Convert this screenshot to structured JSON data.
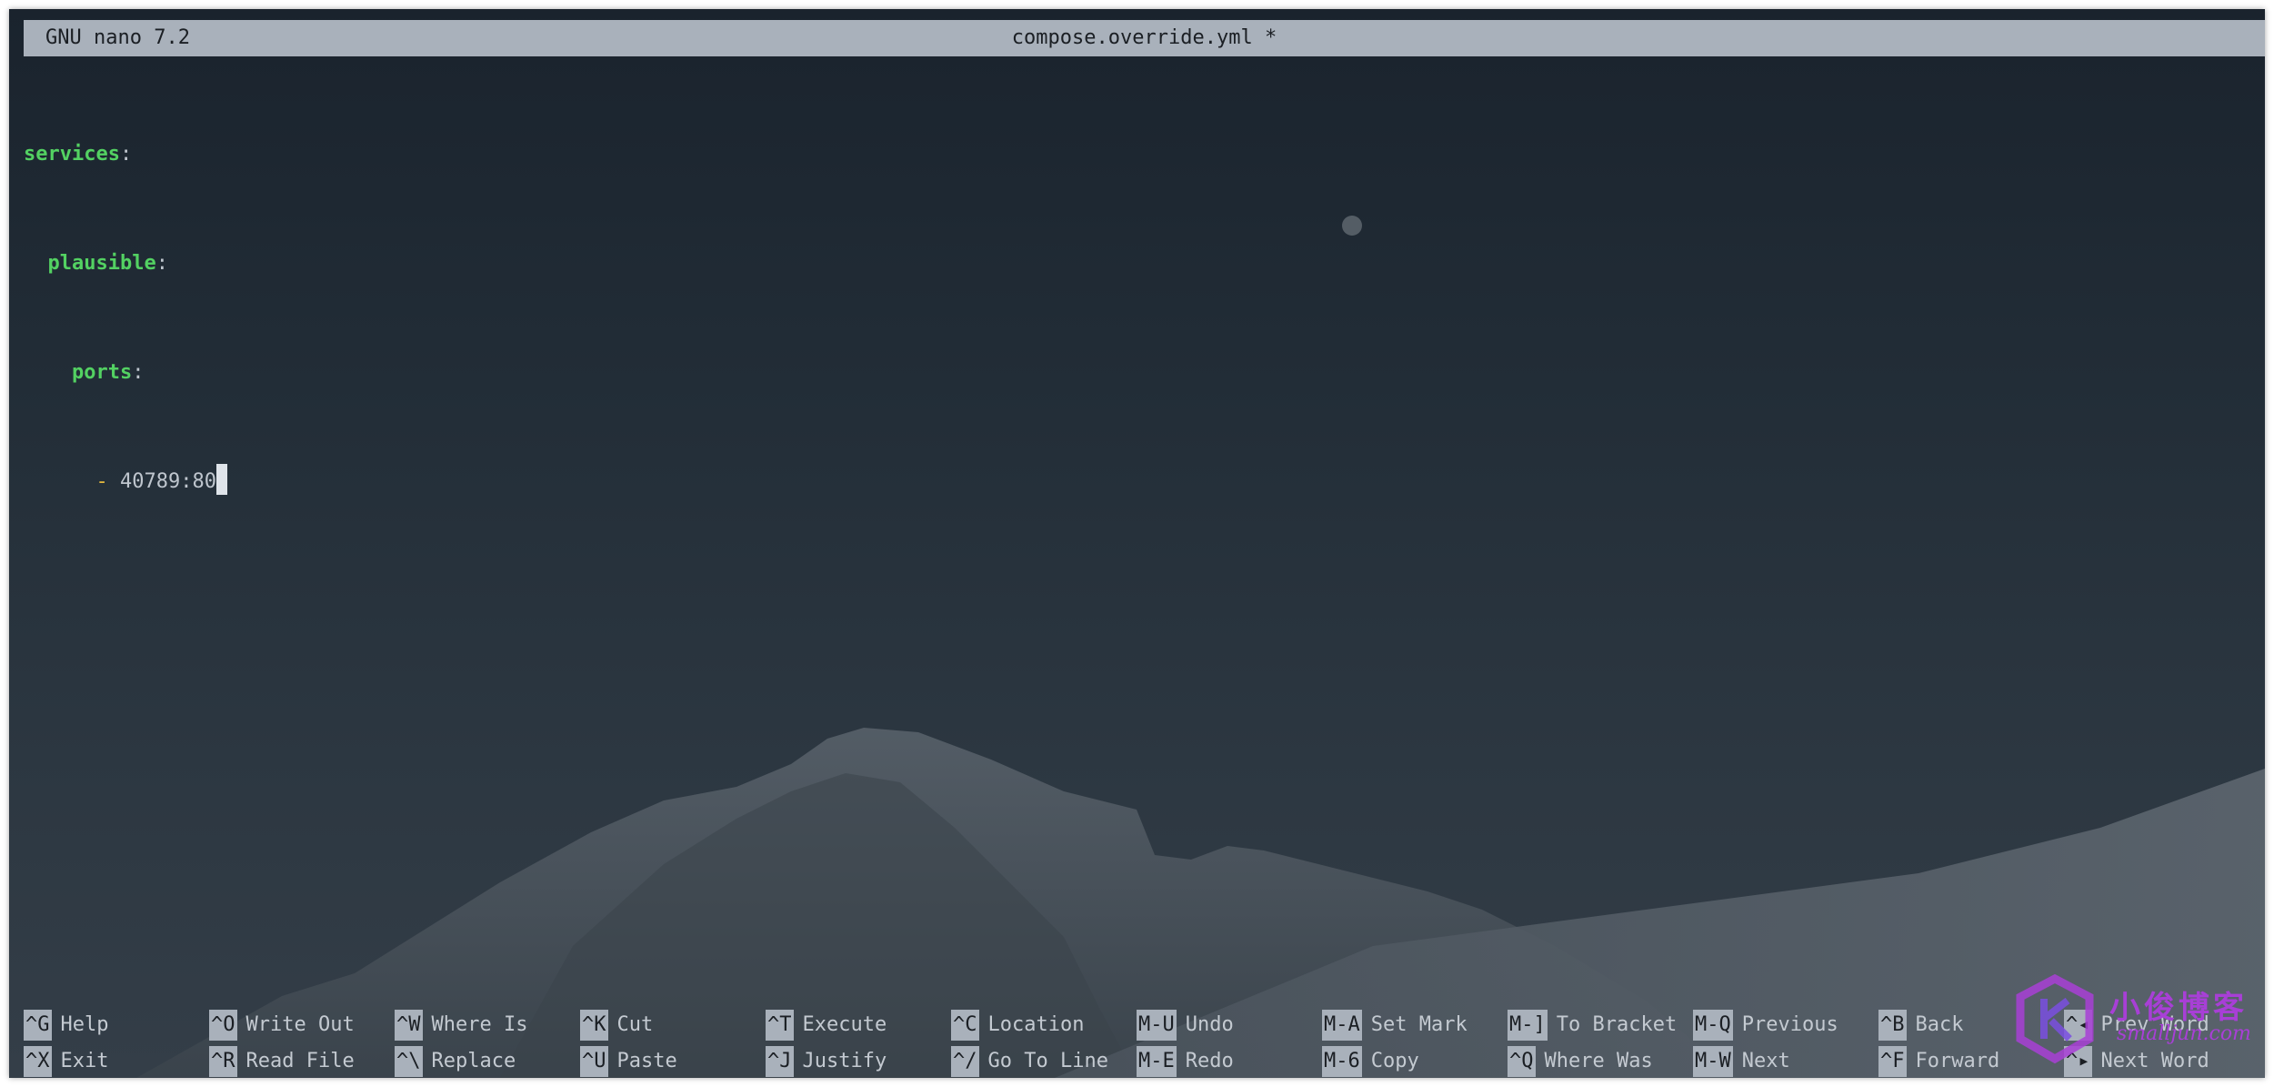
{
  "titlebar": {
    "version": "GNU nano 7.2",
    "filename": "compose.override.yml *"
  },
  "editor": {
    "line1_key": "services",
    "line2_key": "plausible",
    "line3_key": "ports",
    "line4_dash": "-",
    "line4_value": "40789:80",
    "colon": ":"
  },
  "shortcuts": [
    {
      "key": "^G",
      "label": "Help"
    },
    {
      "key": "^O",
      "label": "Write Out"
    },
    {
      "key": "^W",
      "label": "Where Is"
    },
    {
      "key": "^K",
      "label": "Cut"
    },
    {
      "key": "^T",
      "label": "Execute"
    },
    {
      "key": "^C",
      "label": "Location"
    },
    {
      "key": "M-U",
      "label": "Undo"
    },
    {
      "key": "M-A",
      "label": "Set Mark"
    },
    {
      "key": "M-]",
      "label": "To Bracket"
    },
    {
      "key": "M-Q",
      "label": "Previous"
    },
    {
      "key": "^B",
      "label": "Back"
    },
    {
      "key": "^◂",
      "label": "Prev Word"
    },
    {
      "key": "^X",
      "label": "Exit"
    },
    {
      "key": "^R",
      "label": "Read File"
    },
    {
      "key": "^\\",
      "label": "Replace"
    },
    {
      "key": "^U",
      "label": "Paste"
    },
    {
      "key": "^J",
      "label": "Justify"
    },
    {
      "key": "^/",
      "label": "Go To Line"
    },
    {
      "key": "M-E",
      "label": "Redo"
    },
    {
      "key": "M-6",
      "label": "Copy"
    },
    {
      "key": "^Q",
      "label": "Where Was"
    },
    {
      "key": "M-W",
      "label": "Next"
    },
    {
      "key": "^F",
      "label": "Forward"
    },
    {
      "key": "^▸",
      "label": "Next Word"
    }
  ],
  "watermark": {
    "text": "小俊博客",
    "url": "smalljun.com"
  },
  "colors": {
    "keyword": "#53d162",
    "dash": "#e2b73e",
    "bar": "#a9b1bb",
    "watermark": "#a83fd6"
  }
}
